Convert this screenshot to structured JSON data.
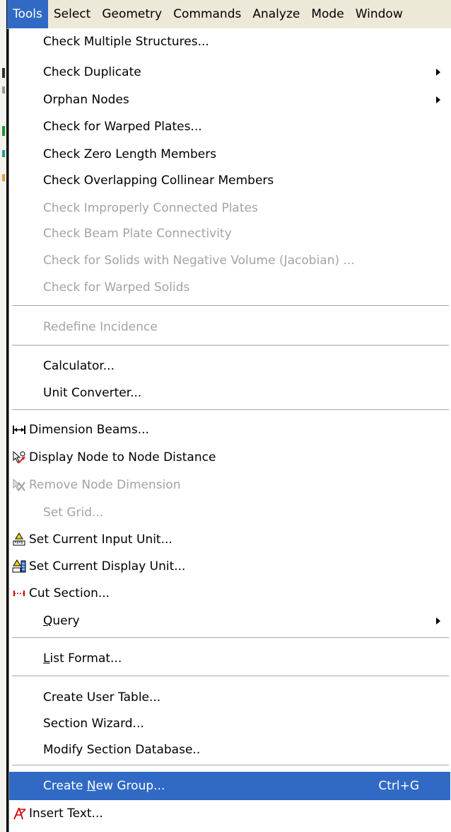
{
  "menubar": {
    "items": [
      {
        "label": "Tools",
        "active": true
      },
      {
        "label": "Select"
      },
      {
        "label": "Geometry"
      },
      {
        "label": "Commands"
      },
      {
        "label": "Analyze"
      },
      {
        "label": "Mode"
      },
      {
        "label": "Window"
      }
    ]
  },
  "menu": {
    "items": [
      {
        "label": "Check Multiple Structures...",
        "enabled": true
      },
      {
        "label": "Check Duplicate",
        "enabled": true,
        "submenu": true
      },
      {
        "label": "Orphan Nodes",
        "enabled": true,
        "submenu": true
      },
      {
        "label": "Check for Warped Plates...",
        "enabled": true
      },
      {
        "label": "Check Zero Length Members",
        "enabled": true
      },
      {
        "label": "Check Overlapping Collinear Members",
        "enabled": true
      },
      {
        "label": "Check Improperly Connected Plates",
        "enabled": false
      },
      {
        "label": "Check Beam Plate Connectivity",
        "enabled": false
      },
      {
        "label": "Check for Solids with Negative Volume (Jacobian) ...",
        "enabled": false
      },
      {
        "label": "Check for Warped Solids",
        "enabled": false
      },
      {
        "label": "Redefine Incidence",
        "enabled": false
      },
      {
        "label": "Calculator...",
        "enabled": true
      },
      {
        "label": "Unit Converter...",
        "enabled": true
      },
      {
        "label": "Dimension Beams...",
        "enabled": true,
        "icon": "dimension-beams-icon"
      },
      {
        "label": "Display Node to Node Distance",
        "enabled": true,
        "icon": "node-distance-icon"
      },
      {
        "label": "Remove Node Dimension",
        "enabled": false,
        "icon": "remove-node-dimension-icon"
      },
      {
        "label": "Set Grid...",
        "enabled": false
      },
      {
        "label": "Set Current Input Unit...",
        "enabled": true,
        "icon": "input-unit-icon"
      },
      {
        "label": "Set Current Display Unit...",
        "enabled": true,
        "icon": "display-unit-icon"
      },
      {
        "label": "Cut Section...",
        "enabled": true,
        "icon": "cut-section-icon"
      },
      {
        "label": "Query",
        "enabled": true,
        "submenu": true,
        "mnemonic": "Q",
        "rest": "uery"
      },
      {
        "label": "List Format...",
        "enabled": true,
        "mnemonic": "L",
        "rest": "ist Format..."
      },
      {
        "label": "Create User Table...",
        "enabled": true
      },
      {
        "label": "Section Wizard...",
        "enabled": true
      },
      {
        "label": "Modify Section Database..",
        "enabled": true
      },
      {
        "label": "Create New Group...",
        "enabled": true,
        "highlighted": true,
        "shortcut": "Ctrl+G",
        "pre": "Create ",
        "mnemonic": "N",
        "rest": "ew Group..."
      },
      {
        "label": "Insert Text...",
        "enabled": true,
        "icon": "insert-text-icon"
      }
    ]
  },
  "colors": {
    "highlight": "#316ac5",
    "disabled_text": "#a4a3a0",
    "menubar_bg": "#ece9d8"
  }
}
